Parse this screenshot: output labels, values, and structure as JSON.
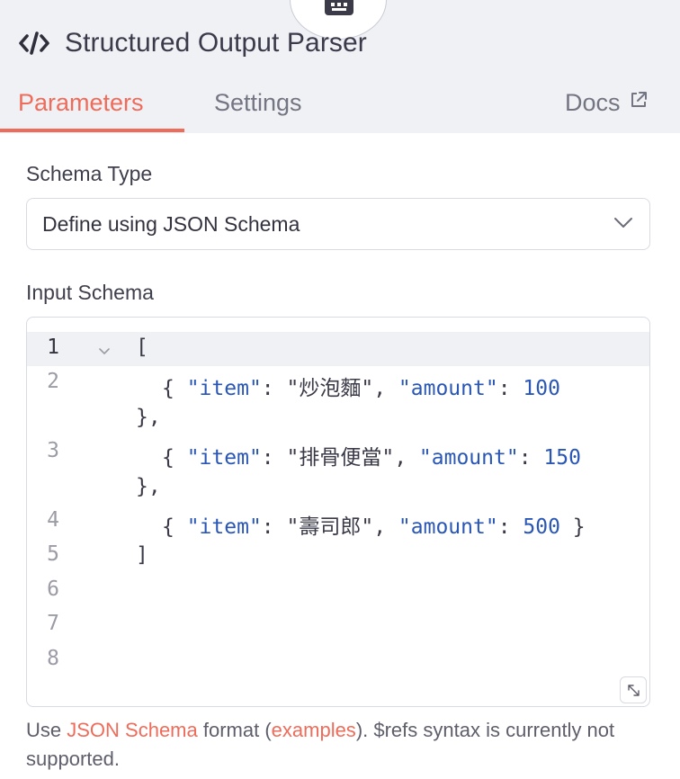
{
  "header": {
    "title": "Structured Output Parser",
    "node_icon": "robot-icon",
    "title_icon": "code-icon"
  },
  "tabs": {
    "parameters": "Parameters",
    "settings": "Settings",
    "docs": "Docs",
    "active": "parameters"
  },
  "schema_type": {
    "label": "Schema Type",
    "value": "Define using JSON Schema"
  },
  "input_schema": {
    "label": "Input Schema",
    "line_numbers": [
      "1",
      "2",
      "3",
      "4",
      "5",
      "6",
      "7",
      "8"
    ],
    "active_line": 1,
    "code": {
      "l1": "[",
      "l2_open": "{ ",
      "l2_key1": "\"item\"",
      "l2_sep1": ": ",
      "l2_val1": "\"炒泡麵\"",
      "l2_comma": ", ",
      "l2_key2": "\"amount\"",
      "l2_sep2": ": ",
      "l2_val2": "100",
      "l2_wrap": "},",
      "l3_open": "{ ",
      "l3_key1": "\"item\"",
      "l3_sep1": ": ",
      "l3_val1": "\"排骨便當\"",
      "l3_comma": ", ",
      "l3_key2": "\"amount\"",
      "l3_sep2": ": ",
      "l3_val2": "150",
      "l3_wrap": "},",
      "l4_open": "{ ",
      "l4_key1": "\"item\"",
      "l4_sep1": ": ",
      "l4_val1": "\"壽司郎\"",
      "l4_comma": ", ",
      "l4_key2": "\"amount\"",
      "l4_sep2": ": ",
      "l4_val2": "500",
      "l4_close": " }",
      "l5": "]"
    }
  },
  "hint": {
    "prefix": "Use ",
    "link1": "JSON Schema",
    "middle": " format (",
    "link2": "examples",
    "suffix": "). $refs syntax is currently not supported."
  },
  "colors": {
    "accent": "#ef6c5a",
    "header_bg": "#f0f1f5",
    "json_key": "#2a57b5"
  }
}
